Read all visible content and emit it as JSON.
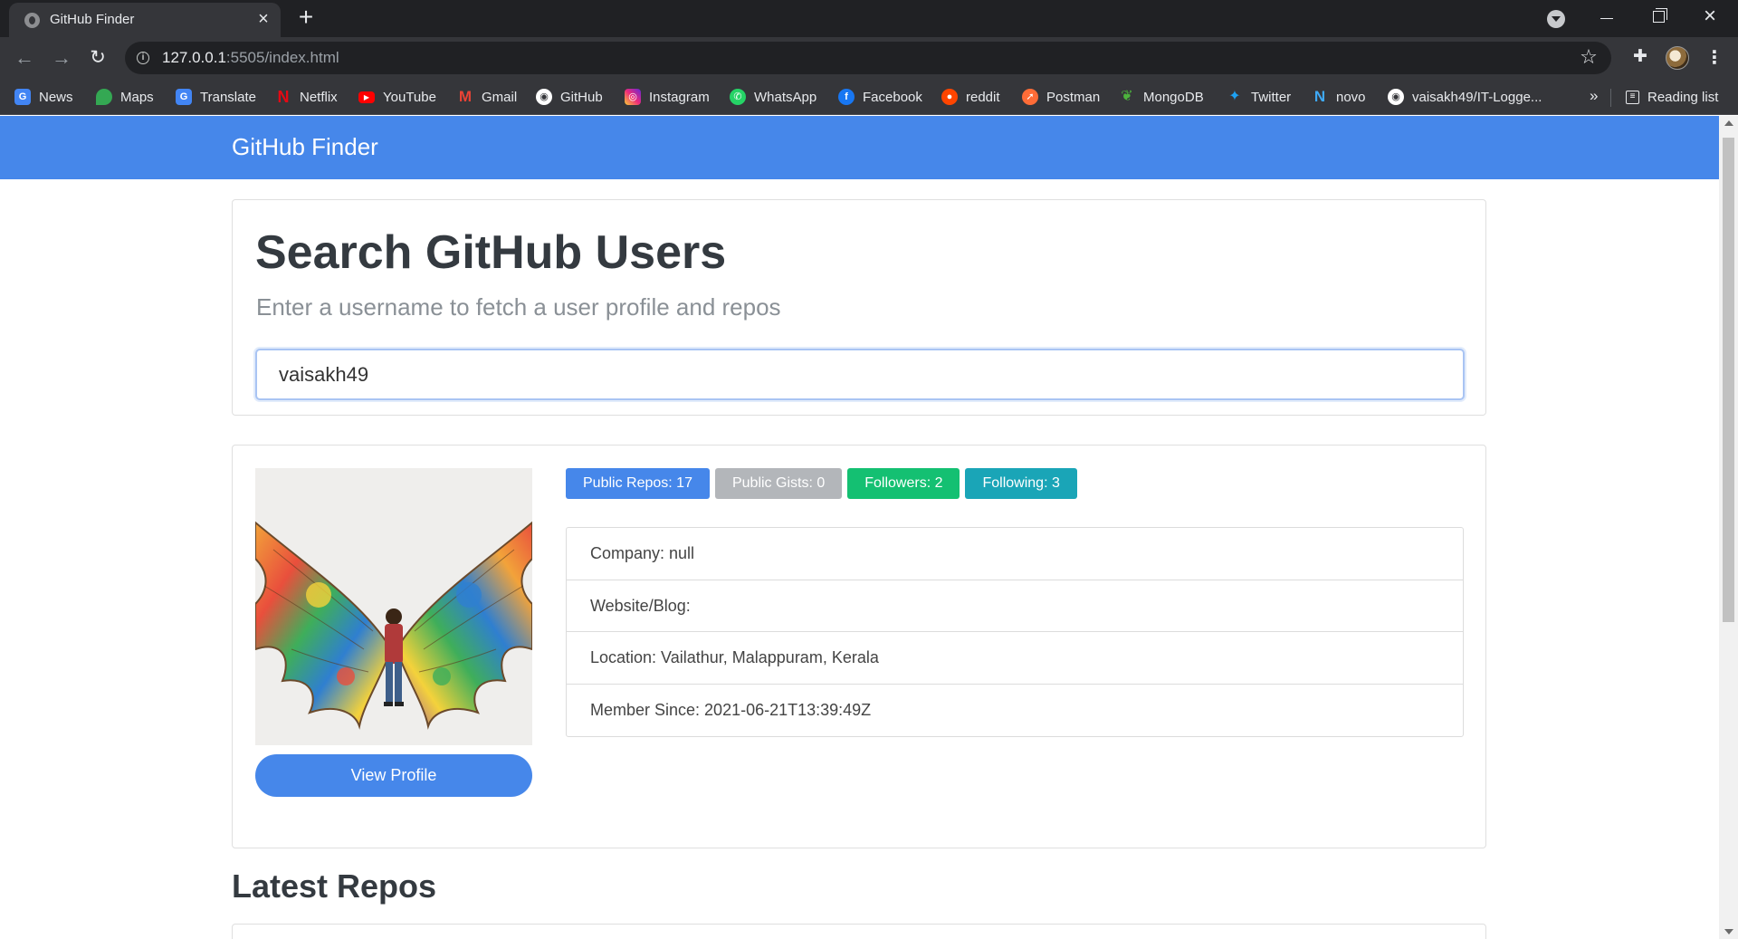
{
  "browser": {
    "tab_title": "GitHub Finder",
    "url_host": "127.0.0.1",
    "url_path": ":5505/index.html",
    "bookmarks": [
      {
        "label": "News",
        "icon": "google-news-icon",
        "color": "#4285f4"
      },
      {
        "label": "Maps",
        "icon": "maps-pin-icon",
        "color": "#34a853"
      },
      {
        "label": "Translate",
        "icon": "translate-icon",
        "color": "#4285f4"
      },
      {
        "label": "Netflix",
        "icon": "netflix-icon",
        "color": "#e50914"
      },
      {
        "label": "YouTube",
        "icon": "youtube-icon",
        "color": "#ff0000"
      },
      {
        "label": "Gmail",
        "icon": "gmail-icon",
        "color": "#ea4335"
      },
      {
        "label": "GitHub",
        "icon": "github-icon",
        "color": "#ffffff"
      },
      {
        "label": "Instagram",
        "icon": "instagram-icon",
        "color": "#d6249f"
      },
      {
        "label": "WhatsApp",
        "icon": "whatsapp-icon",
        "color": "#25d366"
      },
      {
        "label": "Facebook",
        "icon": "facebook-icon",
        "color": "#1877f2"
      },
      {
        "label": "reddit",
        "icon": "reddit-icon",
        "color": "#ff4500"
      },
      {
        "label": "Postman",
        "icon": "postman-icon",
        "color": "#ff6c37"
      },
      {
        "label": "MongoDB",
        "icon": "mongodb-leaf-icon",
        "color": "#4db33d"
      },
      {
        "label": "Twitter",
        "icon": "twitter-icon",
        "color": "#1da1f2"
      },
      {
        "label": "novo",
        "icon": "novo-icon",
        "color": "#3fa9f5"
      },
      {
        "label": "vaisakh49/IT-Logge...",
        "icon": "github-icon",
        "color": "#ffffff"
      }
    ],
    "overflow_label": "»",
    "reading_list_label": "Reading list"
  },
  "page": {
    "brand": "GitHub Finder",
    "search": {
      "title": "Search GitHub Users",
      "lead": "Enter a username to fetch a user profile and repos",
      "value": "vaisakh49"
    },
    "profile": {
      "view_profile_label": "View Profile",
      "badges": {
        "repos": "Public Repos: 17",
        "gists": "Public Gists: 0",
        "followers": "Followers: 2",
        "following": "Following: 3"
      },
      "company": "Company: null",
      "website": "Website/Blog:",
      "location": "Location: Vailathur, Malappuram, Kerala",
      "member_since": "Member Since: 2021-06-21T13:39:49Z"
    },
    "repos_heading": "Latest Repos"
  },
  "colors": {
    "navbar": "#4687ea",
    "badge_repos": "#4687ea",
    "badge_gists": "#b3b6ba",
    "badge_followers": "#14c072",
    "badge_following": "#1aa5b7"
  }
}
